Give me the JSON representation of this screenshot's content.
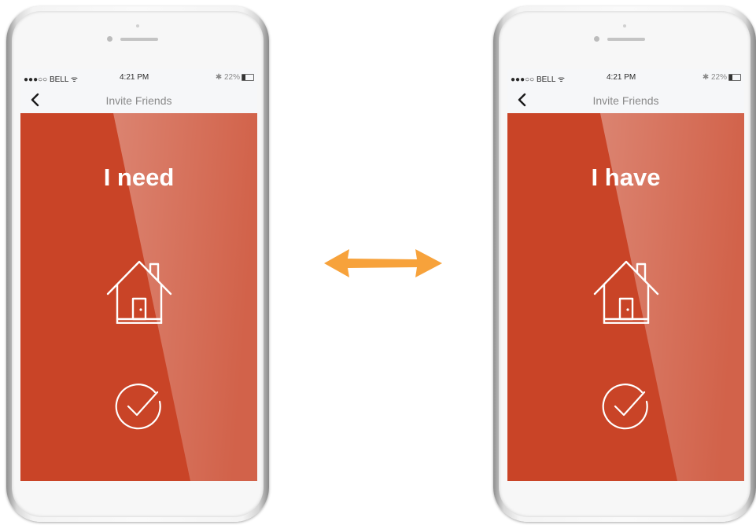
{
  "colors": {
    "brand_red": "#c94427",
    "arrow_orange": "#f7a23b",
    "phone_silver": "#f4f4f4"
  },
  "phones": [
    {
      "status": {
        "carrier": "●●●○○ BELL ᯤ",
        "time": "4:21 PM",
        "battery": "✱ 22%"
      },
      "nav": {
        "back_icon": "chevron-left-icon",
        "title": "Invite Friends"
      },
      "content": {
        "headline": "I need",
        "main_icon": "house-icon",
        "action_icon": "check-circle-icon"
      }
    },
    {
      "status": {
        "carrier": "●●●○○ BELL ᯤ",
        "time": "4:21 PM",
        "battery": "✱ 22%"
      },
      "nav": {
        "back_icon": "chevron-left-icon",
        "title": "Invite Friends"
      },
      "content": {
        "headline": "I have",
        "main_icon": "house-icon",
        "action_icon": "check-circle-icon"
      }
    }
  ],
  "connector": {
    "icon": "double-arrow-icon"
  }
}
